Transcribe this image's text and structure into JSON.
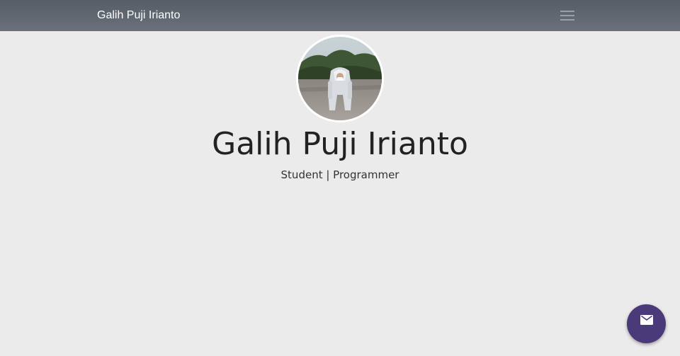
{
  "navbar": {
    "brand": "Galih Puji Irianto",
    "menu_icon": "hamburger-menu-icon"
  },
  "profile": {
    "photo_icon": "profile-photo",
    "name": "Galih Puji Irianto",
    "tagline": "Student | Programmer"
  },
  "fab": {
    "icon": "mail-icon",
    "color": "#4b3a7a"
  },
  "colors": {
    "navbar": "#5f656f",
    "background": "#ebebeb",
    "accent": "#4b3a7a"
  }
}
